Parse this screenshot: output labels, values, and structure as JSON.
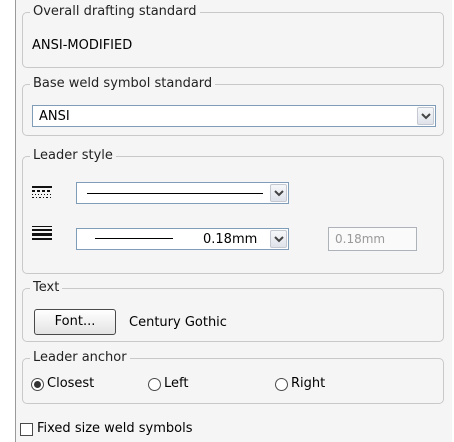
{
  "drafting": {
    "legend": "Overall drafting standard",
    "value": "ANSI-MODIFIED"
  },
  "base_weld": {
    "legend": "Base weld symbol standard",
    "value": "ANSI"
  },
  "leader_style": {
    "legend": "Leader style",
    "thickness_value": "0.18mm",
    "custom_thickness": "0.18mm",
    "style_icon": "line-style-icon",
    "thickness_icon": "line-thickness-icon"
  },
  "text": {
    "legend": "Text",
    "font_button": "Font...",
    "font_name": "Century Gothic"
  },
  "leader_anchor": {
    "legend": "Leader anchor",
    "options": [
      "Closest",
      "Left",
      "Right"
    ],
    "selected": "Closest"
  },
  "fixed_size": {
    "label": "Fixed size weld symbols",
    "checked": false
  },
  "colors": {
    "border": "#c9c9c9",
    "combo_border": "#7f9db9",
    "panel_bg": "#f5f5f5"
  }
}
